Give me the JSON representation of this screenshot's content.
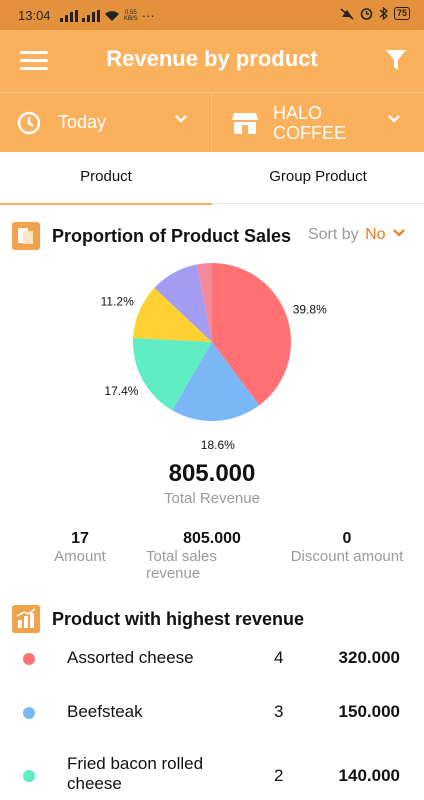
{
  "status_bar": {
    "time": "13:04",
    "speed_value": "0.55",
    "speed_unit": "KB/S",
    "battery": "75"
  },
  "header": {
    "title": "Revenue by product"
  },
  "filters": {
    "date_label": "Today",
    "store_label": "HALO COFFEE"
  },
  "tabs": [
    {
      "label": "Product",
      "active": true
    },
    {
      "label": "Group Product",
      "active": false
    }
  ],
  "proportion": {
    "title": "Proportion of Product Sales",
    "sort_by_label": "Sort by",
    "sort_by_value": "No"
  },
  "chart_data": {
    "type": "pie",
    "slices": [
      {
        "value": 39.8,
        "label": "39.8%",
        "color": "#ff7173"
      },
      {
        "value": 18.6,
        "label": "18.6%",
        "color": "#7bb7f7"
      },
      {
        "value": 17.4,
        "label": "17.4%",
        "color": "#5fedc3"
      },
      {
        "value": 11.2,
        "label": "11.2%",
        "color": "#ffd133"
      },
      {
        "value": 9.9,
        "label": "9.9%",
        "color": "#a39cf2"
      },
      {
        "value": 3.1,
        "label": "",
        "color": "#f5889a"
      }
    ]
  },
  "summary": {
    "total_value": "805.000",
    "total_caption": "Total Revenue",
    "amount_value": "17",
    "amount_caption": "Amount",
    "sales_value": "805.000",
    "sales_caption": "Total sales revenue",
    "discount_value": "0",
    "discount_caption": "Discount amount"
  },
  "highest": {
    "title": "Product with highest revenue",
    "items": [
      {
        "name": "Assorted cheese",
        "qty": "4",
        "revenue": "320.000",
        "color": "#ff7173"
      },
      {
        "name": "Beefsteak",
        "qty": "3",
        "revenue": "150.000",
        "color": "#7bb7f7"
      },
      {
        "name": "Fried bacon rolled cheese",
        "qty": "2",
        "revenue": "140.000",
        "color": "#5fedc3"
      }
    ]
  }
}
